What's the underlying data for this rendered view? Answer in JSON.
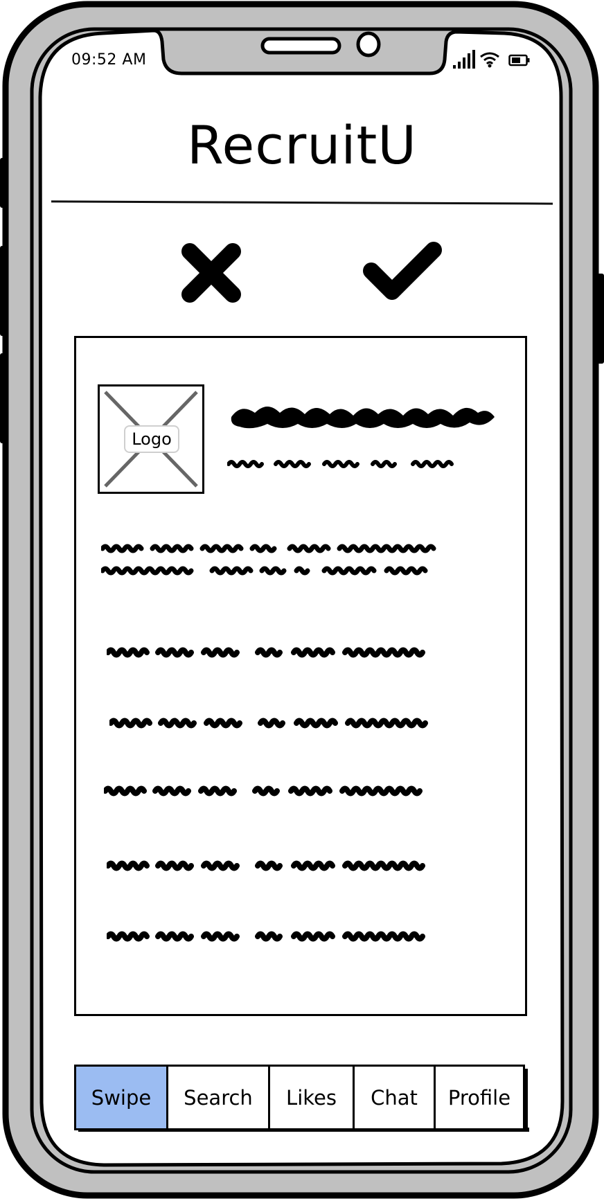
{
  "status_bar": {
    "time": "09:52 AM",
    "icons": [
      "signal-icon",
      "wifi-icon",
      "battery-icon"
    ]
  },
  "app": {
    "title": "RecruitU"
  },
  "actions": {
    "reject_icon": "close-x-icon",
    "accept_icon": "checkmark-icon"
  },
  "card": {
    "logo_label": "Logo",
    "logo_placeholder_icon": "image-placeholder-icon"
  },
  "tabs": [
    {
      "label": "Swipe",
      "active": true
    },
    {
      "label": "Search",
      "active": false
    },
    {
      "label": "Likes",
      "active": false
    },
    {
      "label": "Chat",
      "active": false
    },
    {
      "label": "Profile",
      "active": false
    }
  ],
  "colors": {
    "frame": "#c0c0c0",
    "active_tab": "#9bbcf2",
    "ink": "#000000"
  }
}
